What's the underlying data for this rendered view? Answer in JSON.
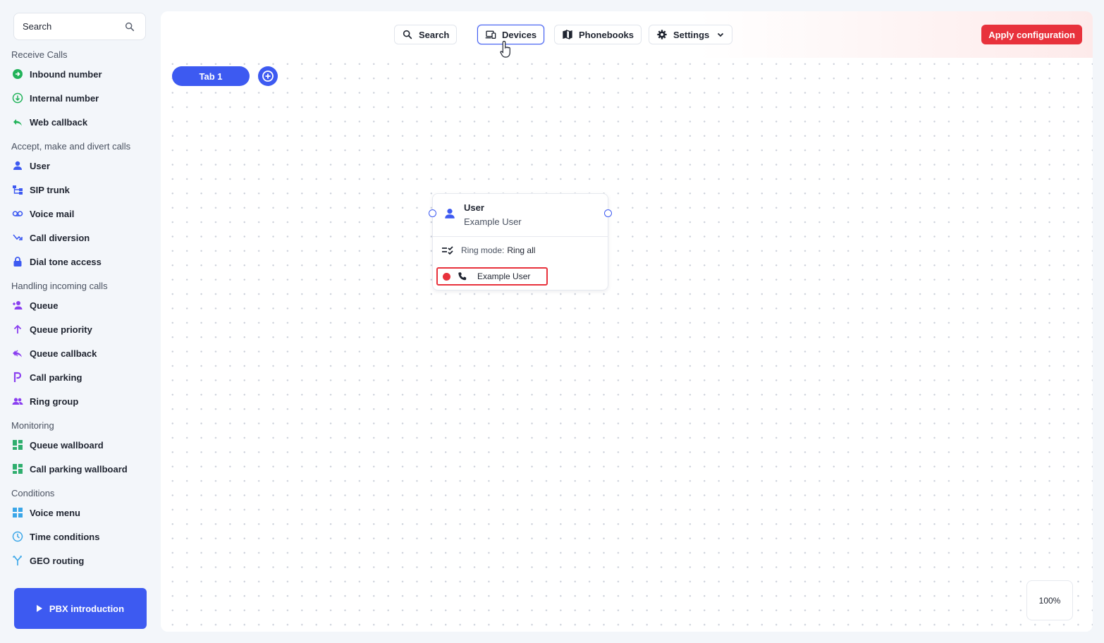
{
  "sidebar": {
    "search": {
      "placeholder": "Search"
    },
    "sections": [
      {
        "title": "Receive Calls",
        "items": [
          {
            "label": "Inbound number",
            "icon": "inbound-number-icon",
            "color": "#22b35a"
          },
          {
            "label": "Internal number",
            "icon": "internal-number-icon",
            "color": "#22b35a"
          },
          {
            "label": "Web callback",
            "icon": "web-callback-icon",
            "color": "#22b35a"
          }
        ]
      },
      {
        "title": "Accept, make and divert calls",
        "items": [
          {
            "label": "User",
            "icon": "user-icon",
            "color": "#3d5af1"
          },
          {
            "label": "SIP trunk",
            "icon": "sip-trunk-icon",
            "color": "#3d5af1"
          },
          {
            "label": "Voice mail",
            "icon": "voicemail-icon",
            "color": "#3d5af1"
          },
          {
            "label": "Call diversion",
            "icon": "call-diversion-icon",
            "color": "#3d5af1"
          },
          {
            "label": "Dial tone access",
            "icon": "lock-icon",
            "color": "#3d5af1"
          }
        ]
      },
      {
        "title": "Handling incoming calls",
        "items": [
          {
            "label": "Queue",
            "icon": "queue-icon",
            "color": "#8a3ff0"
          },
          {
            "label": "Queue priority",
            "icon": "arrow-up-icon",
            "color": "#8a3ff0"
          },
          {
            "label": "Queue callback",
            "icon": "queue-callback-icon",
            "color": "#8a3ff0"
          },
          {
            "label": "Call parking",
            "icon": "parking-icon",
            "color": "#8a3ff0"
          },
          {
            "label": "Ring group",
            "icon": "ring-group-icon",
            "color": "#8a3ff0"
          }
        ]
      },
      {
        "title": "Monitoring",
        "items": [
          {
            "label": "Queue wallboard",
            "icon": "wallboard-icon",
            "color": "#2fae6e"
          },
          {
            "label": "Call parking wallboard",
            "icon": "wallboard-icon",
            "color": "#2fae6e"
          }
        ]
      },
      {
        "title": "Conditions",
        "items": [
          {
            "label": "Voice menu",
            "icon": "voice-menu-icon",
            "color": "#3aa6e8"
          },
          {
            "label": "Time conditions",
            "icon": "clock-icon",
            "color": "#3aa6e8"
          },
          {
            "label": "GEO routing",
            "icon": "geo-routing-icon",
            "color": "#3aa6e8"
          }
        ]
      }
    ],
    "pbx_button": "PBX introduction"
  },
  "toolbar": {
    "search": "Search",
    "devices": "Devices",
    "phonebooks": "Phonebooks",
    "settings": "Settings",
    "apply": "Apply configuration"
  },
  "tabs": [
    {
      "label": "Tab 1",
      "active": true
    }
  ],
  "node": {
    "type": "User",
    "name": "Example User",
    "ring_mode_label": "Ring mode:",
    "ring_mode_value": "Ring all",
    "device": {
      "label": "Example User",
      "status_color": "#e8323c"
    }
  },
  "zoom": "100%",
  "colors": {
    "accent": "#3d5af1",
    "danger": "#e8323c"
  }
}
